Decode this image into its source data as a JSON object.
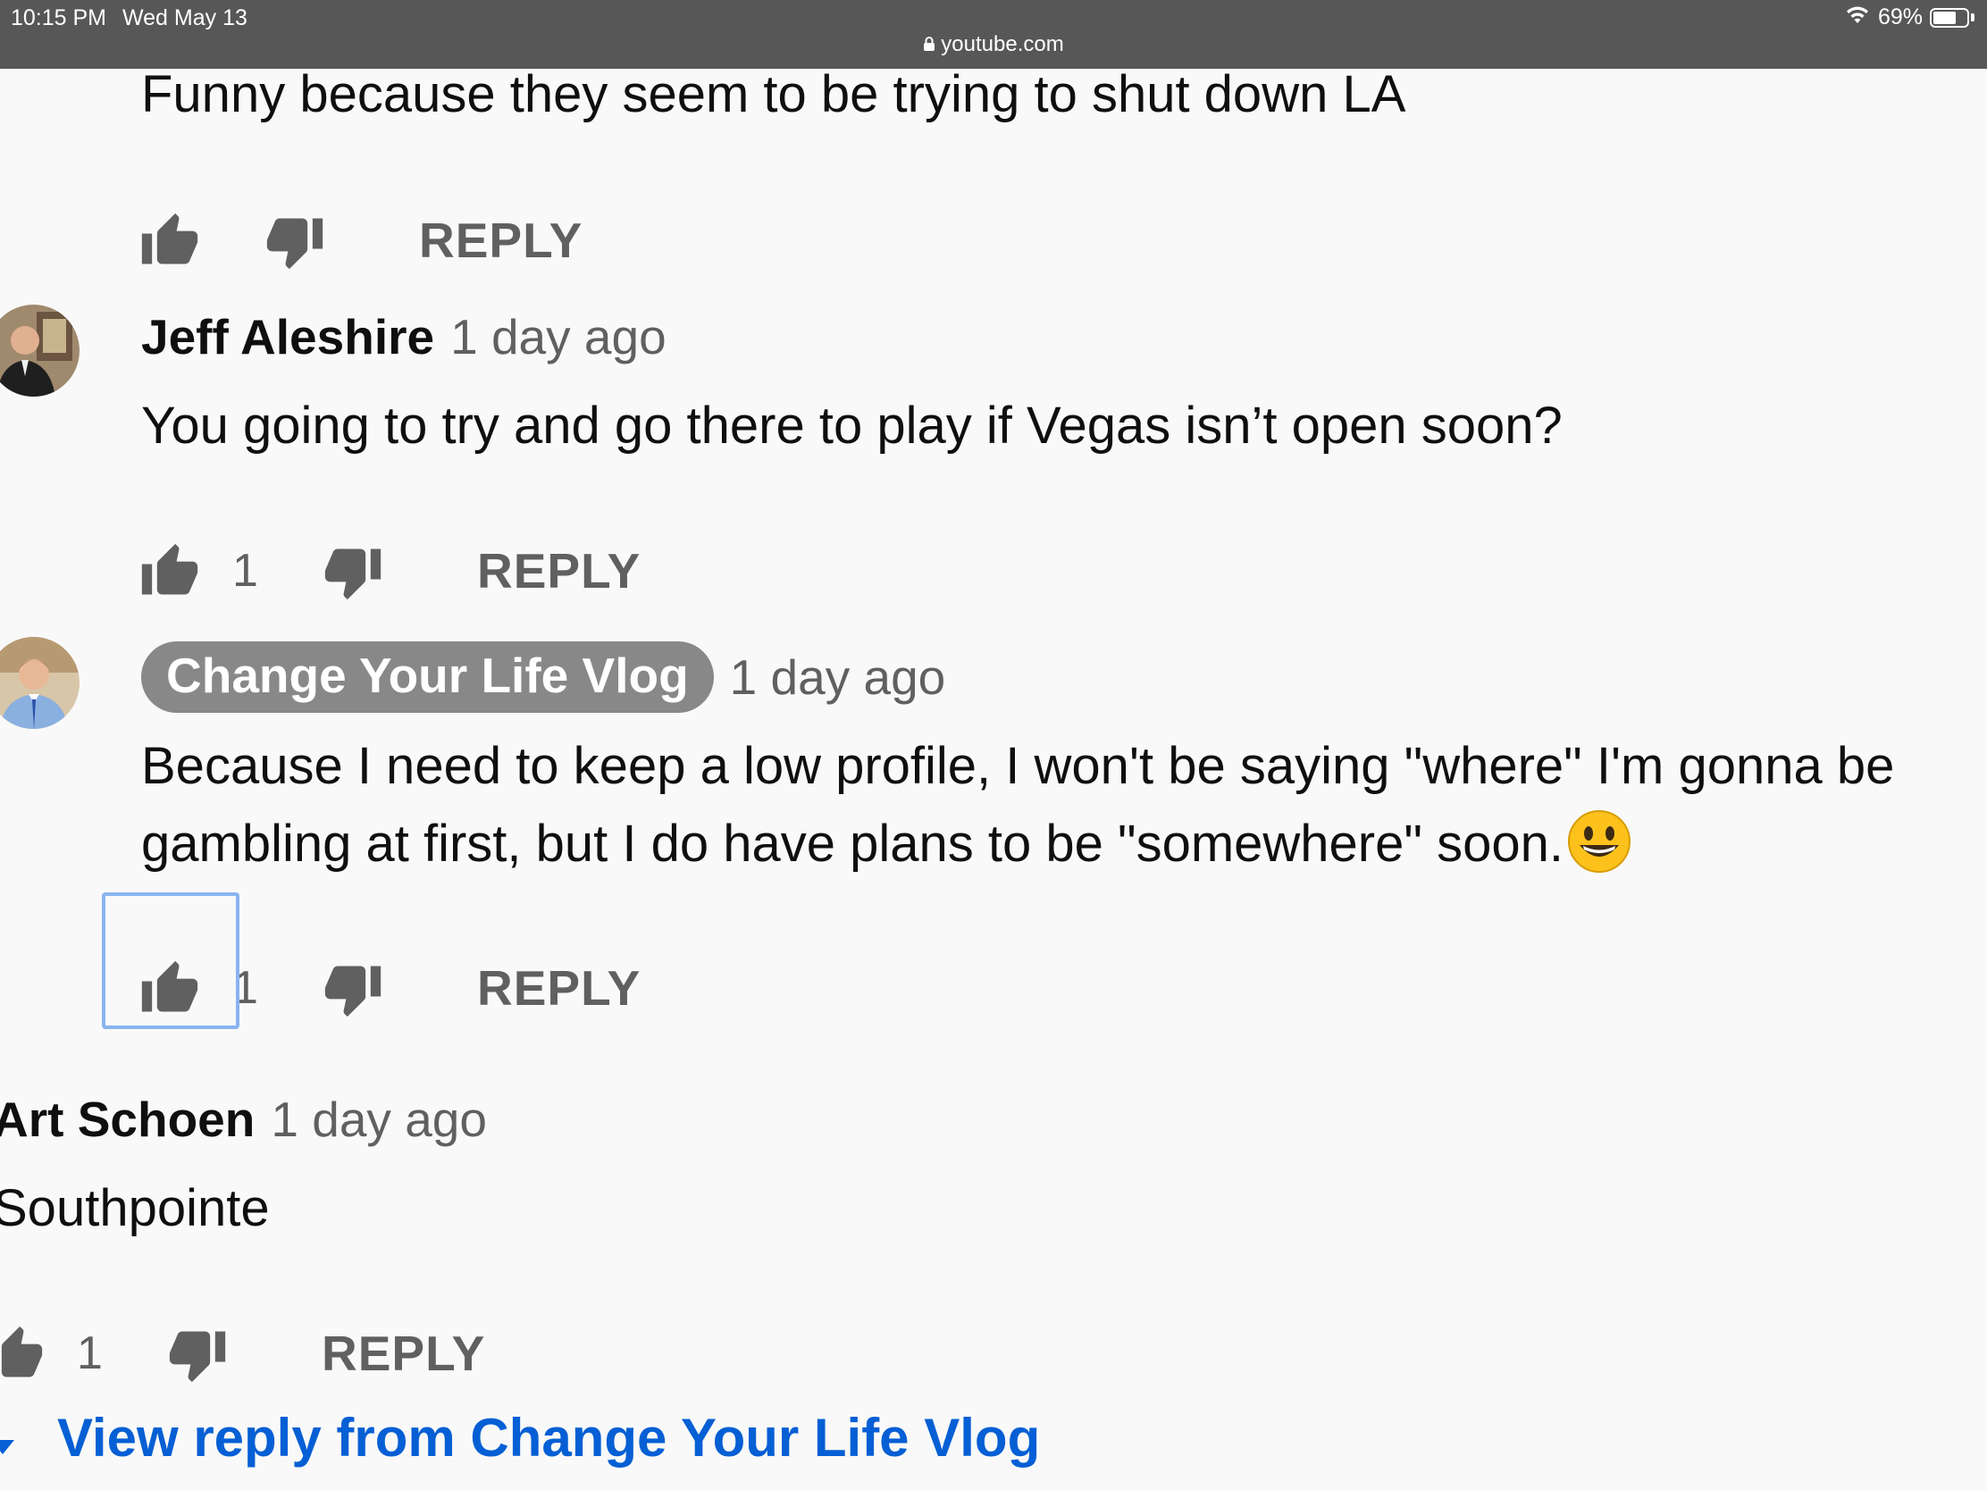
{
  "status_bar": {
    "time": "10:15 PM",
    "date": "Wed May 13",
    "battery": "69%",
    "battery_level": 0.69,
    "url": "youtube.com"
  },
  "colors": {
    "status_bar_bg": "#575757",
    "page_bg": "#f9f9f9",
    "link_blue": "#065fd4",
    "secondary_text": "#606060",
    "chip_bg": "#888888",
    "focus_ring": "#8ab4f0"
  },
  "comments": [
    {
      "text": "Funny because they seem to be trying to shut down LA",
      "reply_label": "REPLY"
    },
    {
      "author": "Jeff Aleshire",
      "age": "1 day ago",
      "text": "You going to try and go there to play if Vegas isn’t open soon?",
      "likes": "1",
      "reply_label": "REPLY"
    },
    {
      "author": "Change Your Life Vlog",
      "author_is_creator": true,
      "age": "1 day ago",
      "text_line1": "Because I need to keep a low profile, I won't be saying \"where\" I'm gonna be",
      "text_line2": "gambling at first, but I do have plans to be \"somewhere\" soon.",
      "emoji": "😀",
      "likes": "1",
      "reply_label": "REPLY"
    },
    {
      "author": "Art Schoen",
      "age": "1 day ago",
      "text": "Southpointe",
      "likes": "1",
      "reply_label": "REPLY"
    }
  ],
  "view_reply": {
    "label": "View reply from Change Your Life Vlog"
  },
  "icons": {
    "like": "thumbs-up-icon",
    "dislike": "thumbs-down-icon",
    "expand": "caret-down-icon",
    "wifi": "wifi-icon",
    "lock": "lock-icon",
    "battery": "battery-icon"
  }
}
